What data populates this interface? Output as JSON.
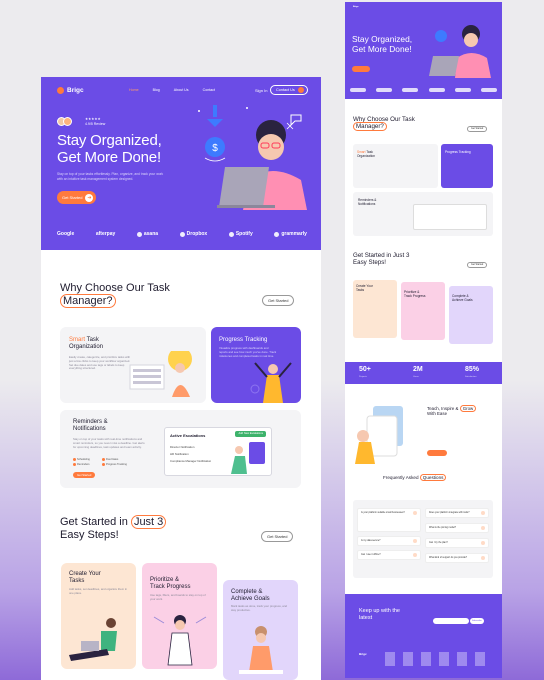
{
  "main": {
    "nav": {
      "logo": "Brigc",
      "links": [
        "Home",
        "Blog",
        "About Us",
        "Contact"
      ],
      "signin": "Sign In",
      "contact": "Contact Us"
    },
    "hero": {
      "rating": "★★★★★",
      "rating_sub": "4.9/5 Review",
      "title_line1": "Stay Organized,",
      "title_line2": "Get More Done!",
      "paragraph": "Stay on top of your tasks effortlessly. Plan, organize, and track your work with an intuitive task management system designed.",
      "cta": "Get Started"
    },
    "brands": [
      "Google",
      "afterpay",
      "asana",
      "Dropbox",
      "Spotify",
      "grammarly"
    ],
    "why": {
      "title_line1": "Why Choose Our Task",
      "title_hl": "Manager?",
      "button": "Get Started",
      "smart_prefix": "Smart",
      "smart_title_rest": "Task",
      "smart_title_line2": "Organization",
      "smart_desc": "Easily create, categorize, and prioritize tasks with just a few clicks to keep your workflow organized. Set due dates and use tags or labels to keep everything structured.",
      "progress_title": "Progress Tracking",
      "progress_desc": "Visualize progress with dashboards and reports and see how much you've done. Track milestones and completed tasks in real time.",
      "rem_title_line1": "Reminders &",
      "rem_title_line2": "Notifications",
      "rem_desc": "Stay on top of your tasks with real-time notifications and smart reminders, so you never miss a deadline. Get alerts for upcoming deadlines, task updates and team activity.",
      "rem_checks": [
        "Scheduling",
        "Due Dates",
        "Reminders",
        "Progress Tracking"
      ],
      "rem_btn": "Get Started",
      "esc_title": "Active Escalations",
      "esc_button": "Add New Escalations",
      "esc_rows": [
        "Director Notification",
        "HR Notification",
        "Compliance Manager Notification"
      ]
    },
    "steps": {
      "title_line1": "Get Started in",
      "title_hl": "Just 3",
      "title_line2": "Easy Steps!",
      "button": "Get Started",
      "s1_line1": "Create Your",
      "s1_line2": "Tasks",
      "s1_desc": "Add tasks, set deadlines, and organize them in one place.",
      "s2_line1": "Prioritize &",
      "s2_line2": "Track Progress",
      "s2_desc": "Use tags, filters, and boards to stay on top of your work.",
      "s3_line1": "Complete &",
      "s3_line2": "Achieve Goals",
      "s3_desc": "Mark tasks as done, track your progress, and stay productive."
    }
  },
  "mini": {
    "title_line1": "Stay Organized,",
    "title_line2": "Get More Done!",
    "why_title_line1": "Why Choose Our Task",
    "why_title_line2": "Manager?",
    "steps_title_line1": "Get Started in Just 3",
    "steps_title_line2": "Easy Steps!",
    "stats": [
      {
        "value": "50+",
        "label": "Projects"
      },
      {
        "value": "2M",
        "label": "Users"
      },
      {
        "value": "85%",
        "label": "Satisfaction"
      }
    ],
    "teach_line1": "Teach, Inspire &",
    "teach_hl": "Grow",
    "teach_line2": "With Ease",
    "faq_title": "Frequently Asked",
    "faq_hl": "Questions",
    "faq_left": [
      "Is your platform suitable small businesses?",
      "Is my data secure?",
      "Can I use it offline?"
    ],
    "faq_right": [
      "Does your platform integrate with tools?",
      "What is the pricing model?",
      "Can I try the plan?",
      "What kind of support do you provide?"
    ],
    "newsletter_line1": "Keep up with the",
    "newsletter_line2": "latest",
    "subscribe": "Subscribe",
    "footer_logo": "Brigc"
  },
  "colors": {
    "primary": "#6b4ce6",
    "accent": "#ff7a3d",
    "peach": "#fde6d3",
    "pink": "#fbd0e6",
    "lavender": "#e2d6fb"
  }
}
